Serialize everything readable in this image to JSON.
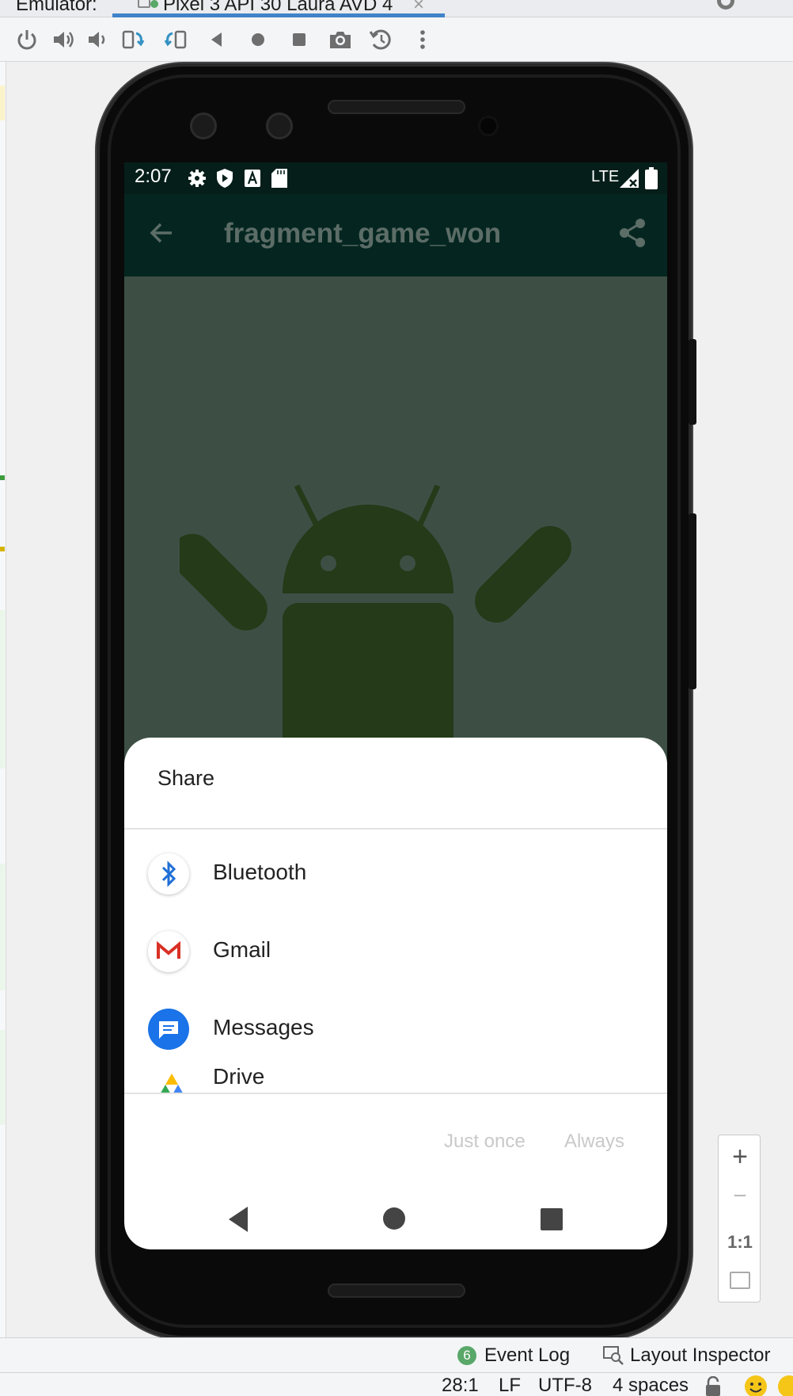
{
  "tabs": [
    {
      "label": "Emulator:"
    },
    {
      "label": "Pixel 3 API 30 Laura AVD 4"
    }
  ],
  "tab_close_glyph": "×",
  "toolbar": {
    "icons": [
      "power-icon",
      "volume-up-icon",
      "volume-down-icon",
      "rotate-left-icon",
      "rotate-right-icon",
      "back-icon",
      "home-icon",
      "overview-icon",
      "camera-icon",
      "snapshot-icon",
      "more-icon"
    ]
  },
  "phone": {
    "status_time": "2:07",
    "network": "LTE",
    "app_title": "fragment_game_won"
  },
  "share_sheet": {
    "title": "Share",
    "items": [
      {
        "label": "Bluetooth",
        "icon": "bluetooth-icon"
      },
      {
        "label": "Gmail",
        "icon": "gmail-icon"
      },
      {
        "label": "Messages",
        "icon": "messages-icon"
      },
      {
        "label": "Drive",
        "icon": "drive-icon"
      }
    ],
    "just_once_label": "Just once",
    "always_label": "Always"
  },
  "zoom": {
    "plus": "+",
    "minus": "−",
    "one_to_one": "1:1"
  },
  "status_bar": {
    "event_log_count": "6",
    "event_log_label": "Event Log",
    "layout_inspector_label": "Layout Inspector",
    "position": "28:1",
    "line_sep": "LF",
    "encoding": "UTF-8",
    "indent": "4 spaces"
  },
  "colors": {
    "accent": "#4083c9",
    "screen_bg": "#3d4f45",
    "app_bar": "#052620",
    "android_green": "#243a18"
  }
}
